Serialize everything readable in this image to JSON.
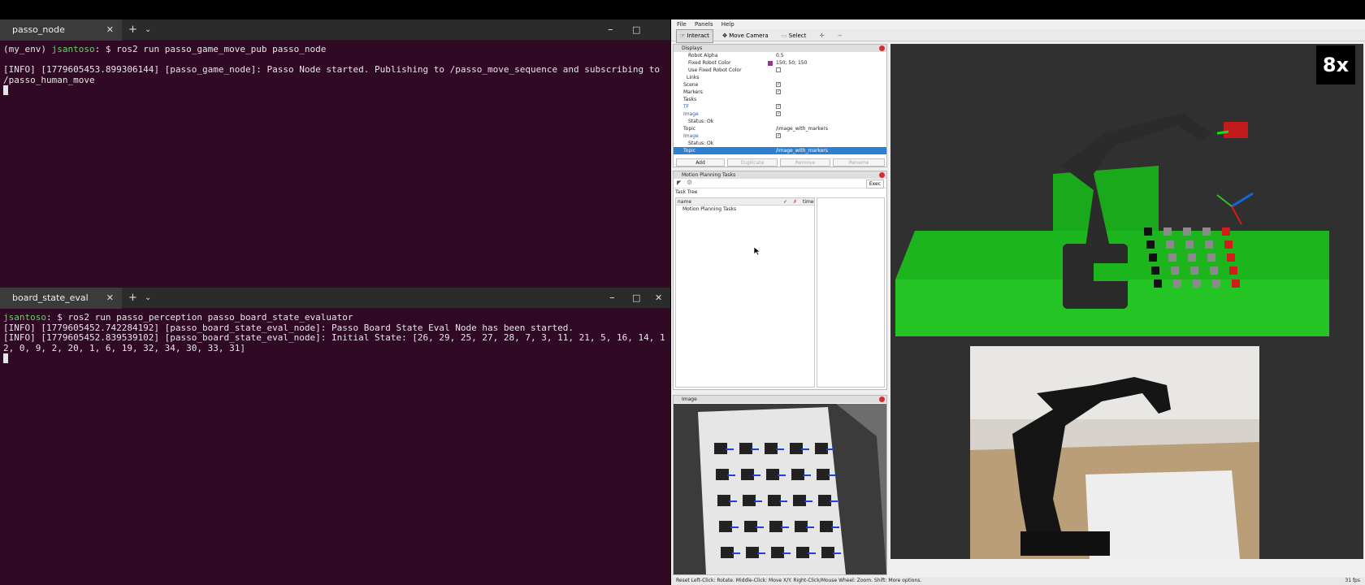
{
  "terminal_top": {
    "tab_title": "passo_node",
    "prompt_env": "(my_env) ",
    "prompt_user": "jsantoso",
    "prompt_suffix": ": $ ",
    "command": "ros2 run passo_game_move_pub passo_node",
    "output_1": "[INFO] [1779605453.899306144] [passo_game_node]: Passo Node started. Publishing to /passo_move_sequence and subscribing to /passo_human_move"
  },
  "terminal_bottom": {
    "tab_title": "board_state_eval",
    "prompt_user": "jsantoso",
    "prompt_suffix": ": $ ",
    "command": "ros2 run passo_perception passo_board_state_evaluator",
    "output_1": "[INFO] [1779605452.742284192] [passo_board_state_eval_node]: Passo Board State Eval Node has been started.",
    "output_2": "[INFO] [1779605452.839539102] [passo_board_state_eval_node]: Initial State: [26, 29, 25, 27, 28, 7, 3, 11, 21, 5, 16, 14, 12, 0, 9, 2, 20, 1, 6, 19, 32, 34, 30, 33, 31]"
  },
  "terminal_controls": {
    "new_tab": "+",
    "dropdown": "⌄",
    "minimize": "–",
    "maximize": "□",
    "close": "✕",
    "tab_close": "✕"
  },
  "rviz": {
    "menu": [
      "File",
      "Panels",
      "Help"
    ],
    "tools": [
      "Interact",
      "Move Camera",
      "Select"
    ],
    "displays_title": "Displays",
    "display_rows": [
      {
        "label": "Robot Alpha",
        "value": "0.5",
        "indent": 18
      },
      {
        "label": "Fixed Robot Color",
        "value": "150; 50; 150",
        "indent": 18
      },
      {
        "label": "Use Fixed Robot Color",
        "value": "",
        "indent": 18
      },
      {
        "label": "Links",
        "value": "",
        "indent": 16
      },
      {
        "label": "Scene",
        "value": "",
        "indent": 12
      },
      {
        "label": "Markers",
        "value": "",
        "indent": 12
      },
      {
        "label": "Tasks",
        "value": "",
        "indent": 12
      },
      {
        "label": "TF",
        "value": "",
        "indent": 12
      },
      {
        "label": "Image",
        "value": "",
        "indent": 12
      },
      {
        "label": "Status: Ok",
        "value": "",
        "indent": 18
      },
      {
        "label": "Topic",
        "value": "/image_with_markers",
        "indent": 12
      },
      {
        "label": "Image",
        "value": "",
        "indent": 12
      },
      {
        "label": "Status: Ok",
        "value": "",
        "indent": 18
      },
      {
        "label": "Topic",
        "value": "/image_with_markers",
        "indent": 12
      }
    ],
    "display_buttons": [
      "Add",
      "Duplicate",
      "Remove",
      "Rename"
    ],
    "mpt_title": "Motion Planning Tasks",
    "mpt_exec": "Exec",
    "task_tree_label": "Task Tree",
    "task_cols": [
      "name",
      "✓",
      "✗",
      "time"
    ],
    "task_item": "Motion Planning Tasks",
    "image_panel_title": "Image",
    "status_text": "Reset   Left-Click: Rotate.  Middle-Click: Move X/Y.  Right-Click/Mouse Wheel: Zoom.  Shift: More options.",
    "fps": "31 fps",
    "color_box": "#963296"
  },
  "speed_badge": "8x"
}
